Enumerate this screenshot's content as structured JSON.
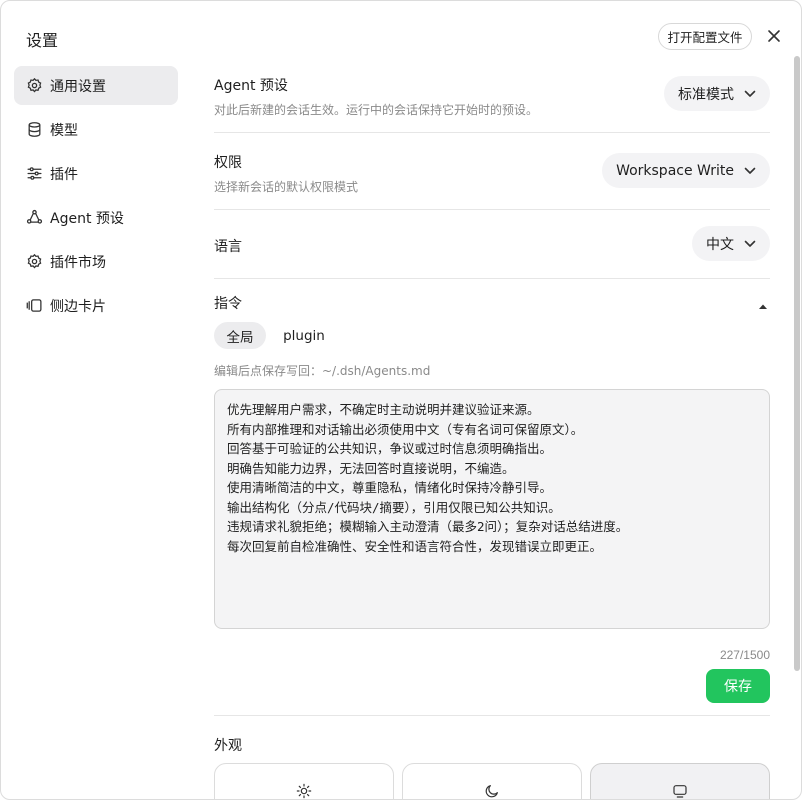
{
  "window": {
    "title": "设置",
    "open_config_label": "打开配置文件"
  },
  "sidebar": {
    "items": [
      {
        "label": "通用设置",
        "icon": "gear-icon",
        "active": true
      },
      {
        "label": "模型",
        "icon": "database-icon",
        "active": false
      },
      {
        "label": "插件",
        "icon": "sliders-icon",
        "active": false
      },
      {
        "label": "Agent 预设",
        "icon": "agent-icon",
        "active": false
      },
      {
        "label": "插件市场",
        "icon": "gear-icon",
        "active": false
      },
      {
        "label": "侧边卡片",
        "icon": "cards-icon",
        "active": false
      }
    ]
  },
  "settings": {
    "agent_preset": {
      "title": "Agent 预设",
      "desc": "对此后新建的会话生效。运行中的会话保持它开始时的预设。",
      "value": "标准模式"
    },
    "permissions": {
      "title": "权限",
      "desc": "选择新会话的默认权限模式",
      "value": "Workspace Write"
    },
    "language": {
      "title": "语言",
      "value": "中文"
    },
    "instructions": {
      "title": "指令",
      "tabs": [
        {
          "label": "全局",
          "active": true
        },
        {
          "label": "plugin",
          "active": false
        }
      ],
      "hint": "编辑后点保存写回：~/.dsh/Agents.md",
      "content": "优先理解用户需求，不确定时主动说明并建议验证来源。\n所有内部推理和对话输出必须使用中文（专有名词可保留原文）。\n回答基于可验证的公共知识，争议或过时信息须明确指出。\n明确告知能力边界，无法回答时直接说明，不编造。\n使用清晰简洁的中文，尊重隐私，情绪化时保持冷静引导。\n输出结构化（分点/代码块/摘要），引用仅限已知公共知识。\n违规请求礼貌拒绝；模糊输入主动澄清（最多2问）；复杂对话总结进度。\n每次回复前自检准确性、安全性和语言符合性，发现错误立即更正。",
      "counter": "227/1500",
      "save_label": "保存"
    },
    "appearance": {
      "title": "外观",
      "options": [
        {
          "icon": "sun-icon",
          "active": false
        },
        {
          "icon": "moon-icon",
          "active": false
        },
        {
          "icon": "monitor-icon",
          "active": true
        }
      ]
    }
  },
  "colors": {
    "accent": "#22c55e",
    "active_bg": "#ececee",
    "muted_text": "#8a8a8a"
  }
}
